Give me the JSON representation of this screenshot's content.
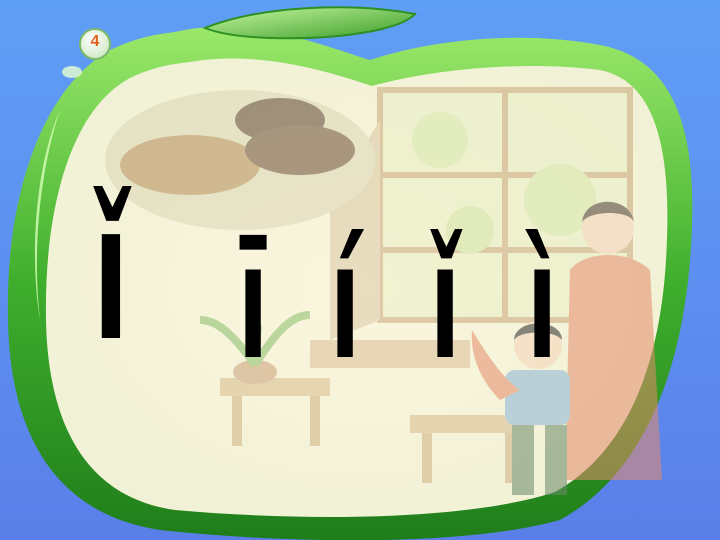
{
  "slide": {
    "badge_number": "4",
    "main_letter": "ǐ",
    "tone_letters": [
      "ī",
      "í",
      "ǐ",
      "ì"
    ]
  },
  "colors": {
    "background": "#5f9ef5",
    "leaf_green": "#3aa82a",
    "leaf_light": "#b9f08a",
    "card": "#f7f1d4",
    "text": "#000000"
  }
}
